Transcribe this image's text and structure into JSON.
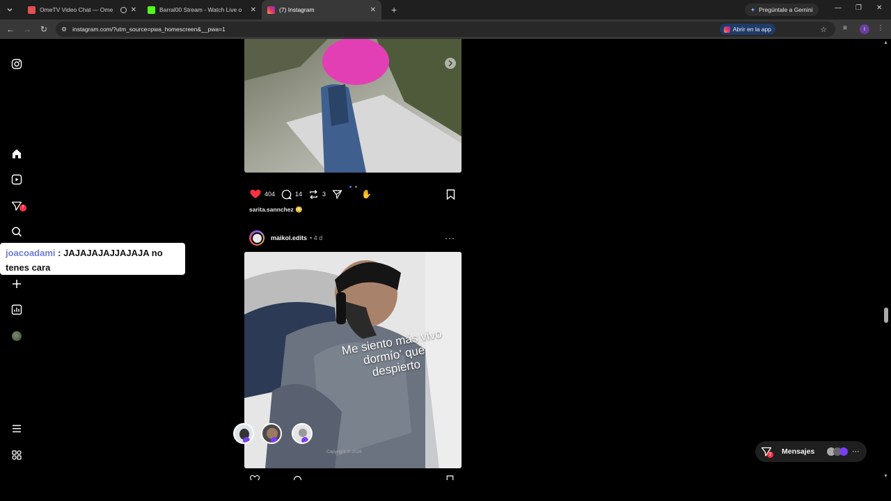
{
  "browser": {
    "tabs": [
      {
        "title": "OmeTV Video Chat — Ome",
        "color": "#e25050",
        "active": false,
        "recording": true
      },
      {
        "title": "Barral00 Stream - Watch Live o",
        "color": "#53fc18",
        "active": false,
        "recording": false
      },
      {
        "title": "(7) Instagram",
        "color": "#e1306c",
        "active": true,
        "recording": false
      }
    ],
    "gemini_label": "Pregúntale a Gemini",
    "url": "instagram.com/?utm_source=pwa_homescreen&__pwa=1",
    "open_app_label": "Abrir en la app",
    "profile_initial": "I"
  },
  "leftnav": {
    "notifications_badge": "7"
  },
  "chat": {
    "user": "joacoadami",
    "separator": " : ",
    "message": "JAJAJAJAJJAJAJA no tenes cara"
  },
  "post1": {
    "likes": "404",
    "comments": "14",
    "reposts": "3",
    "caption_user": "sarita.sannchez",
    "caption_emoji": "😳"
  },
  "post2": {
    "username": "maikol.edits",
    "time": "• 4 d",
    "overlay_text": "Me siento más vivo dormío' que despierto",
    "copyright": "Copyright © 2026"
  },
  "messages": {
    "label": "Mensajes",
    "badge": "7"
  },
  "colors": {
    "like": "#ff3040",
    "badge": "#ff3040",
    "open_app_bg": "#1f3b66"
  }
}
